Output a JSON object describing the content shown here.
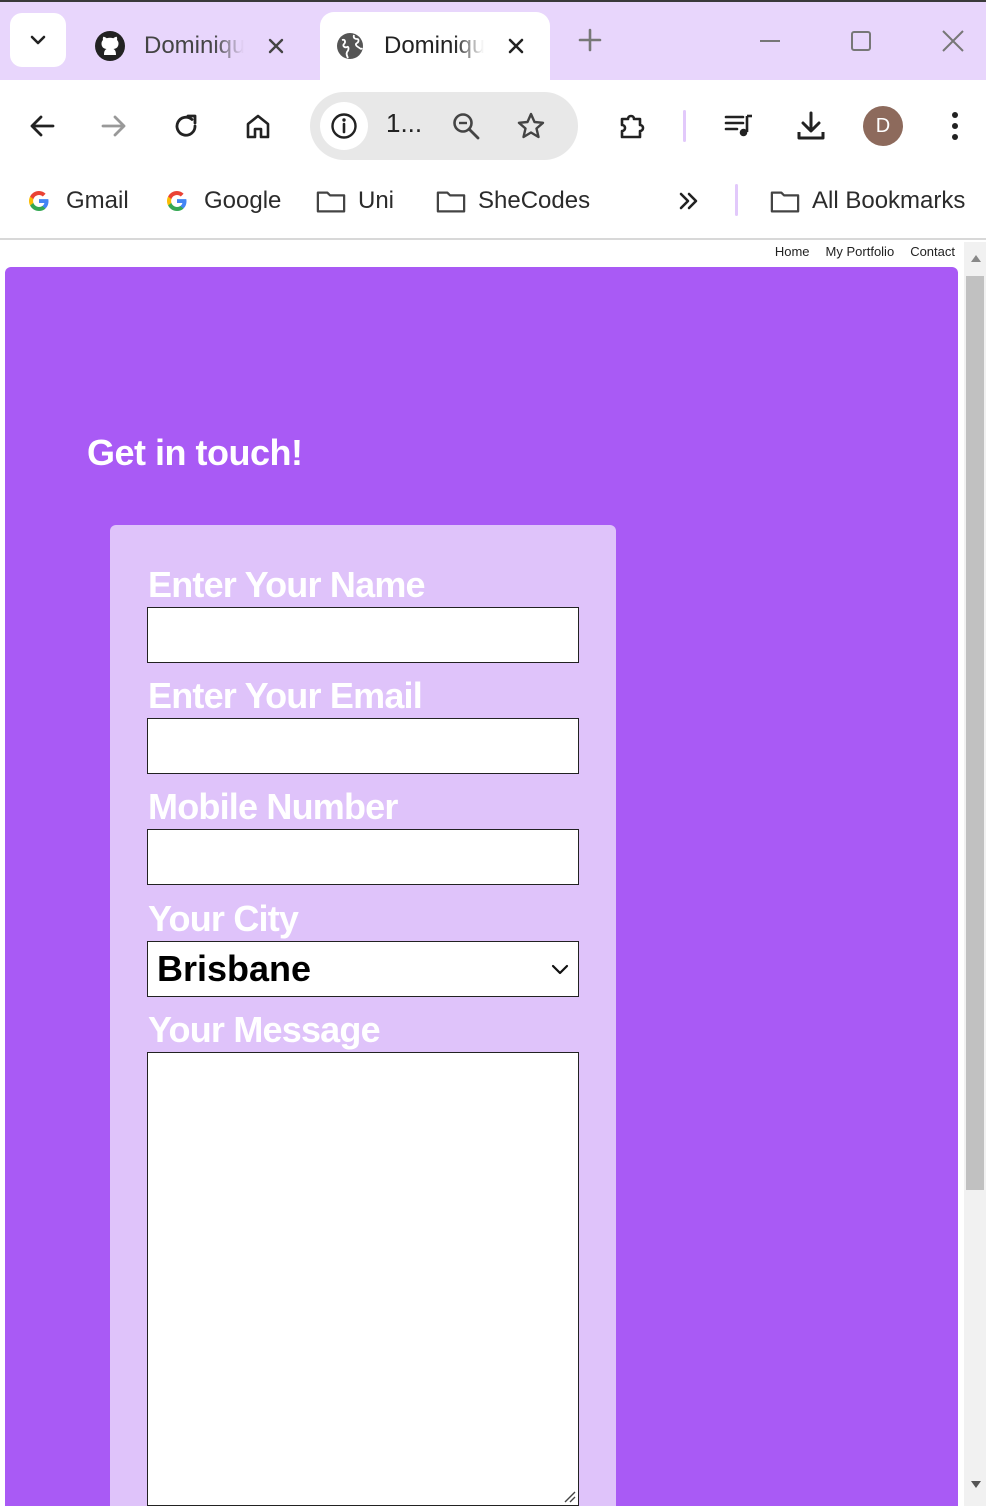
{
  "browser": {
    "tabs": [
      {
        "title": "Dominique",
        "favicon": "github-icon",
        "active": false
      },
      {
        "title": "Dominique",
        "favicon": "globe-icon",
        "active": true
      }
    ],
    "address": {
      "url_text": "1..."
    },
    "profile_initial": "D",
    "bookmarks": [
      {
        "label": "Gmail",
        "icon": "google-icon"
      },
      {
        "label": "Google",
        "icon": "google-icon"
      },
      {
        "label": "Uni",
        "icon": "folder-icon"
      },
      {
        "label": "SheCodes",
        "icon": "folder-icon"
      }
    ],
    "all_bookmarks_label": "All Bookmarks",
    "colors": {
      "tabstrip": "#e8d6fc",
      "avatar": "#8d6a5c"
    }
  },
  "page": {
    "nav": [
      {
        "label": "Home"
      },
      {
        "label": "My Portfolio"
      },
      {
        "label": "Contact"
      }
    ],
    "heading": "Get in touch!",
    "form": {
      "name_label": "Enter Your Name",
      "name_value": "",
      "email_label": "Enter Your Email",
      "email_value": "",
      "mobile_label": "Mobile Number",
      "mobile_value": "",
      "city_label": "Your City",
      "city_selected": "Brisbane",
      "message_label": "Your Message",
      "message_value": ""
    },
    "colors": {
      "hero": "#a95af5",
      "form_card": "#dfc3fa"
    }
  }
}
